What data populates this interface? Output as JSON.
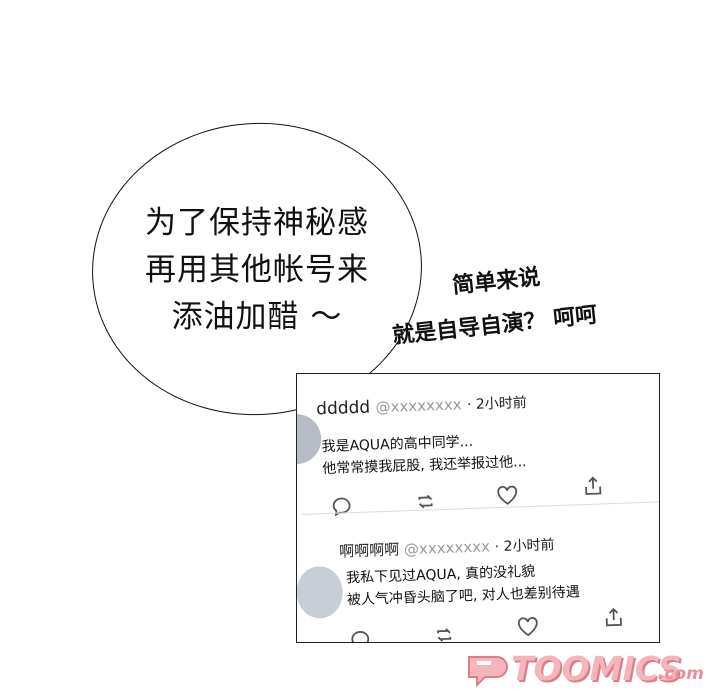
{
  "bubble": {
    "lines": [
      "为了保持神秘感",
      "再用其他帐号来",
      "添油加醋 ～"
    ]
  },
  "captions": {
    "line1": "简单来说",
    "line2": "就是自导自演？ 呵呵"
  },
  "posts": [
    {
      "username": "ddddd",
      "handle": "@xxxxxxxx",
      "time": "· 2小时前",
      "lines": [
        "我是AQUA的高中同学...",
        "他常常摸我屁股, 我还举报过他..."
      ]
    },
    {
      "username": "啊啊啊啊",
      "handle": "@xxxxxxxx",
      "time": "· 2小时前",
      "lines": [
        "我私下见过AQUA, 真的没礼貌",
        "被人气冲昏头脑了吧, 对人也差别待遇"
      ]
    }
  ],
  "actions": [
    "comment-icon",
    "retweet-icon",
    "like-icon",
    "share-icon"
  ],
  "watermark": {
    "text": "TOOMICS",
    "domain": ".com",
    "color": "#f4b5bb"
  }
}
